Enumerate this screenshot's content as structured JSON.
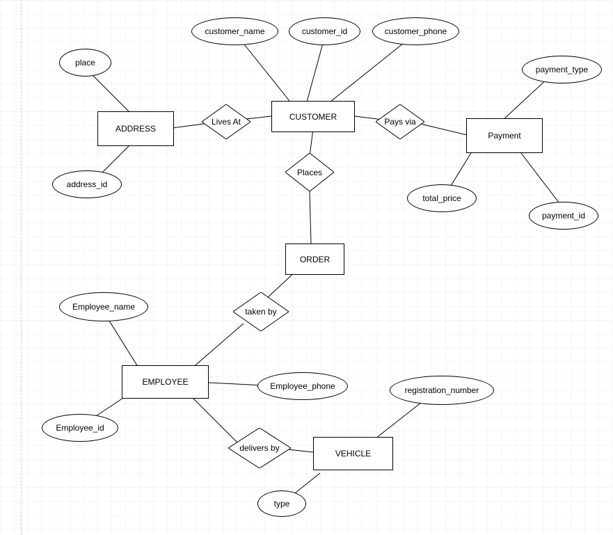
{
  "entities": {
    "customer": "CUSTOMER",
    "address": "ADDRESS",
    "payment": "Payment",
    "order": "ORDER",
    "employee": "EMPLOYEE",
    "vehicle": "VEHICLE"
  },
  "relationships": {
    "lives_at": "Lives At",
    "pays_via": "Pays via",
    "places": "Places",
    "taken_by": "taken by",
    "delivers_by": "delivers by"
  },
  "attributes": {
    "place": "place",
    "address_id": "address_id",
    "customer_name": "customer_name",
    "customer_id": "customer_id",
    "customer_phone": "customer_phone",
    "payment_type": "payment_type",
    "payment_id": "payment_id",
    "total_price": "total_price",
    "employee_name": "Employee_name",
    "employee_id": "Employee_id",
    "employee_phone": "Employee_phone",
    "registration_number": "registration_number",
    "type": "type"
  }
}
